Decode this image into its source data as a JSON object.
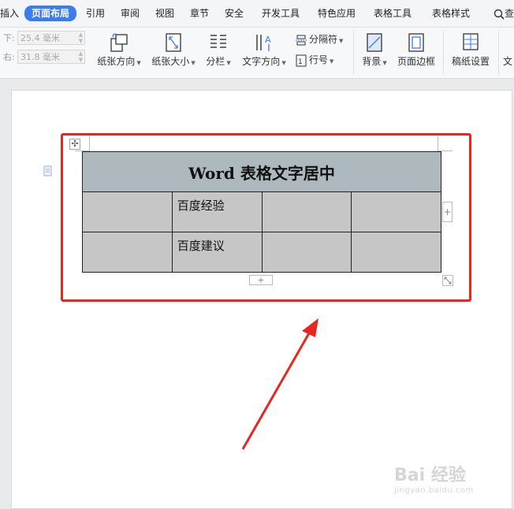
{
  "ribbon": {
    "tabs": [
      "插入",
      "页面布局",
      "引用",
      "审阅",
      "视图",
      "章节",
      "安全",
      "开发工具",
      "特色应用",
      "表格工具",
      "表格样式"
    ],
    "active_tab": "页面布局",
    "search_label": "查",
    "accent_color": "#3b7cf1"
  },
  "toolbar": {
    "margins": {
      "bottom_label": "下:",
      "bottom_value": "25.4 毫米",
      "right_label": "右:",
      "right_value": "31.8 毫米"
    },
    "buttons": {
      "orientation": "纸张方向",
      "size": "纸张大小",
      "columns": "分栏",
      "text_direction": "文字方向",
      "breaks": "分隔符",
      "line_numbers": "行号",
      "background": "背景",
      "page_border": "页面边框",
      "manuscript": "稿纸设置",
      "text_cut": "文"
    }
  },
  "document": {
    "table": {
      "title": "Word 表格文字居中",
      "rows": [
        [
          "",
          "百度经验",
          "",
          ""
        ],
        [
          "",
          "百度建议",
          "",
          ""
        ]
      ],
      "header_bg": "#adb8bf",
      "cell_bg": "#c6c6c6"
    },
    "add_col_symbol": "+",
    "add_row_symbol": "+",
    "move_symbol": "✣"
  },
  "annotation": {
    "highlight_color": "#e8251f"
  },
  "watermark": {
    "brand": "Bai 经验",
    "url": "jingyan.baidu.com"
  }
}
